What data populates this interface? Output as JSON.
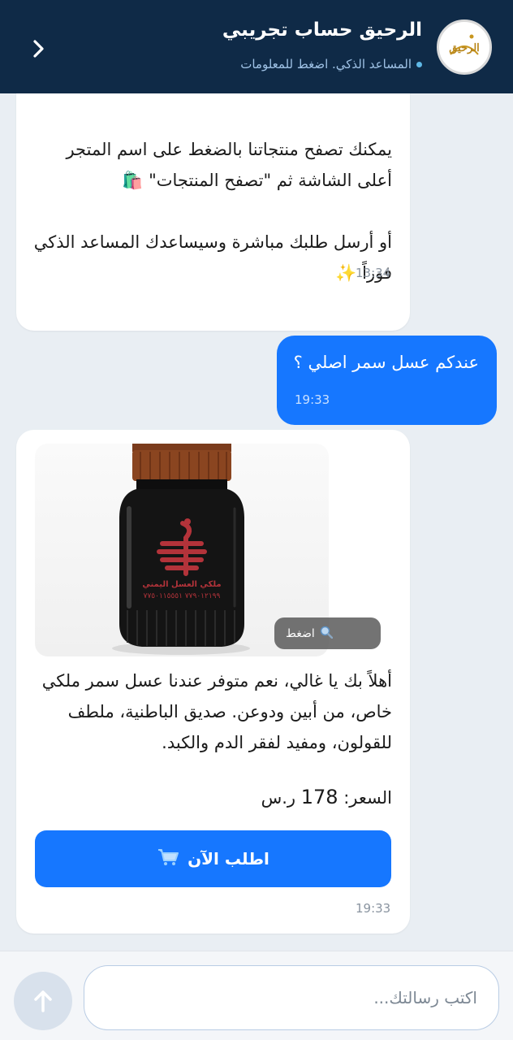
{
  "header": {
    "title": "الرحيق  حساب تجريبي",
    "subtitle": "المساعد الذكي. اضغط للمعلومات",
    "logo_text": "الرحيق"
  },
  "messages": [
    {
      "direction": "incoming",
      "text": "يمكنك تصفح منتجاتنا بالضغط على اسم المتجر أعلى الشاشة ثم \"تصفح المنتجات\" 🛍️\n\nأو أرسل طلبك مباشرة وسيساعدك المساعد الذكي فوراً ✨",
      "time": "13:34"
    },
    {
      "direction": "outgoing",
      "text": "عندكم عسل سمر اصلي ؟",
      "time": "19:33"
    },
    {
      "direction": "incoming",
      "image_label": "ملكي العسل اليمني",
      "image_phone": "٧٧٩٠١٢١٩٩ ٧٧٥٠١١٥٥٥١",
      "zoom_label": "اضغط",
      "text": "أهلاً بك يا غالي، نعم متوفر عندنا عسل سمر ملكي خاص، من أبين ودوعن. صديق الباطنية، ملطف للقولون، ومفيد لفقر الدم والكبد.",
      "price_label": "السعر:",
      "price_value": "178",
      "currency": "ر.س",
      "order_button": "اطلب الآن",
      "time": "19:33"
    }
  ],
  "composer": {
    "placeholder": "اكتب رسالتك..."
  },
  "colors": {
    "header_bg": "#0f2a47",
    "accent": "#1677ff",
    "chat_bg": "#e9eef3"
  }
}
